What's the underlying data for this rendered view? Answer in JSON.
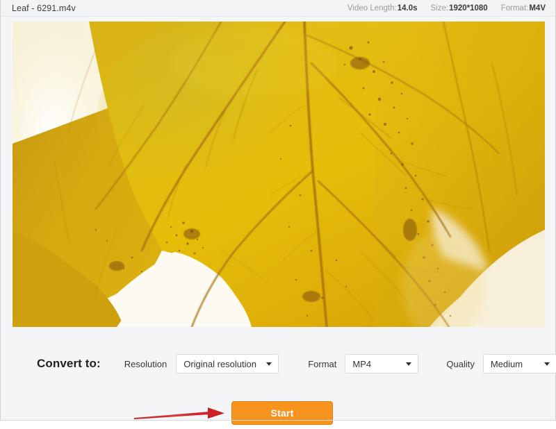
{
  "header": {
    "file_title": "Leaf - 6291.m4v",
    "meta": [
      {
        "label": "Video Length:",
        "value": "14.0s"
      },
      {
        "label": "Size:",
        "value": "1920*1080"
      },
      {
        "label": "Format:",
        "value": "M4V"
      }
    ]
  },
  "preview": {
    "alt": "Close-up of a yellow autumn maple leaf with dark veins against a blurred cream background"
  },
  "controls": {
    "convert_label": "Convert to:",
    "resolution": {
      "label": "Resolution",
      "value": "Original resolution"
    },
    "format": {
      "label": "Format",
      "value": "MP4"
    },
    "quality": {
      "label": "Quality",
      "value": "Medium"
    },
    "start_label": "Start"
  },
  "colors": {
    "accent_button": "#f7941e",
    "accent_button_border": "#e07b12",
    "annotation_arrow": "#cc2027",
    "panel_background": "#f4f5f7",
    "header_background": "#f2f3f5",
    "leaf_yellow": "#e2b50c",
    "leaf_vein": "#a9700c",
    "background_cream": "#f7efd4"
  }
}
